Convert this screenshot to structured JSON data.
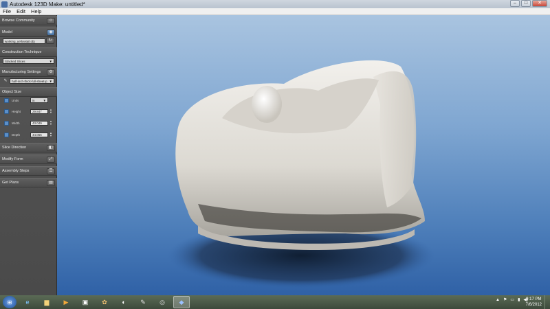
{
  "window": {
    "title": "Autodesk 123D Make: untitled*",
    "buttons": {
      "minimize": "–",
      "maximize": "□",
      "close": "✕"
    }
  },
  "menu": [
    "File",
    "Edit",
    "Help"
  ],
  "panel": {
    "browse_community": "Browse Community",
    "model": {
      "label": "Model",
      "file": "working_yellowtail.obj"
    },
    "construction": {
      "label": "Construction Technique",
      "value": "Stacked Slices"
    },
    "manufacturing": {
      "label": "Manufacturing Settings",
      "value": "half-inch-thick-full-sheet-p"
    },
    "object_size": {
      "label": "Object Size",
      "units_label": "Units",
      "units_value": "in",
      "height_label": "Height",
      "height_value": "29.847",
      "width_label": "Width",
      "width_value": "43.049",
      "depth_label": "Depth",
      "depth_value": "44.066"
    },
    "slice_direction": "Slice Direction",
    "modify_form": "Modify Form",
    "assembly_steps": "Assembly Steps",
    "get_plans": "Get Plans"
  },
  "taskbar": {
    "clock_time": "9:17 PM",
    "clock_date": "7/6/2012",
    "apps": [
      "windows-start",
      "internet-explorer",
      "file-explorer",
      "media-player",
      "app-generic",
      "photos",
      "app-viewer",
      "paint",
      "chrome",
      "123d-make"
    ]
  }
}
